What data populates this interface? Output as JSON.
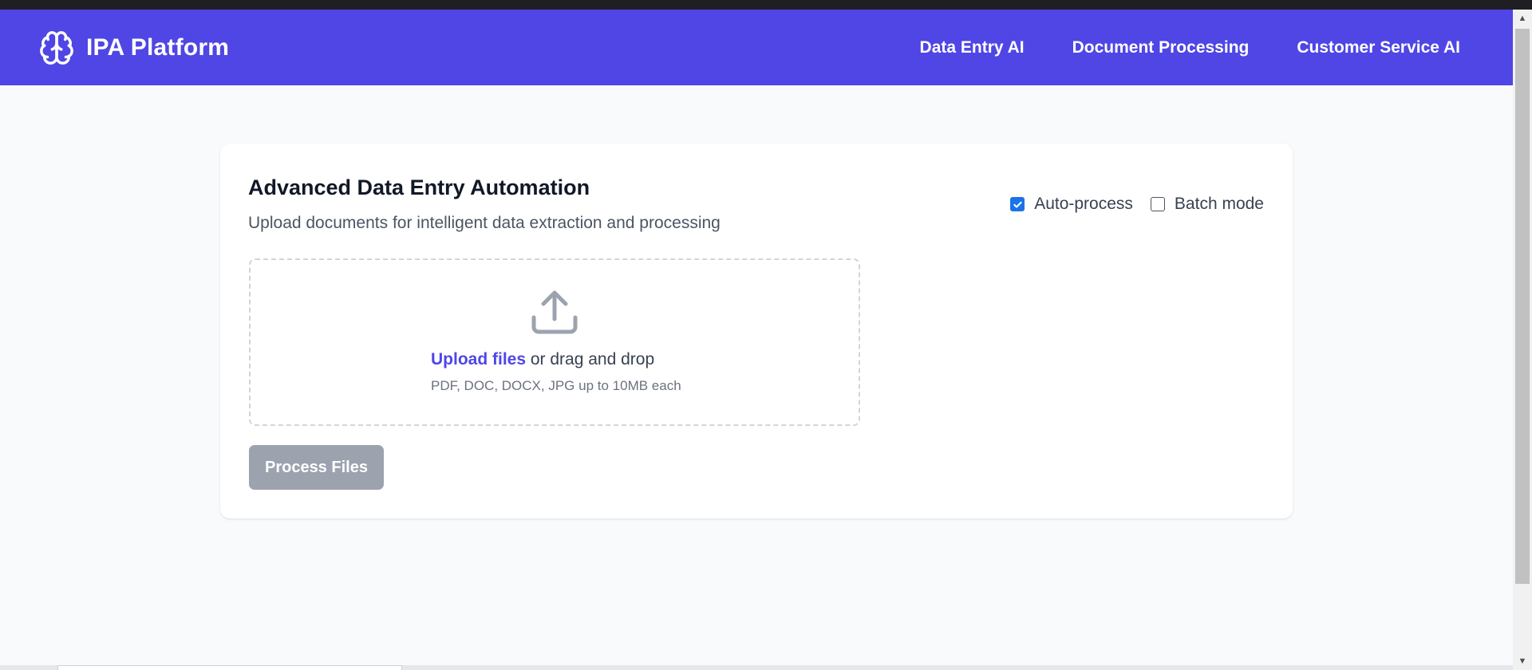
{
  "brand": {
    "title": "IPA Platform",
    "icon": "brain-icon"
  },
  "nav": {
    "links": [
      {
        "label": "Data Entry AI"
      },
      {
        "label": "Document Processing"
      },
      {
        "label": "Customer Service AI"
      }
    ]
  },
  "card": {
    "title": "Advanced Data Entry Automation",
    "subtitle": "Upload documents for intelligent data extraction and processing",
    "options": [
      {
        "label": "Auto-process",
        "checked": true
      },
      {
        "label": "Batch mode",
        "checked": false
      }
    ],
    "dropzone": {
      "icon": "upload-icon",
      "link_label": "Upload files",
      "rest_label": " or drag and drop",
      "hint": "PDF, DOC, DOCX, JPG up to 10MB each"
    },
    "process_button": {
      "label": "Process Files",
      "disabled": true
    }
  },
  "colors": {
    "primary": "#4f46e5",
    "background": "#f9fafb",
    "card": "#ffffff",
    "button_disabled": "#9ca3af",
    "checkbox_checked": "#1a73e8"
  }
}
